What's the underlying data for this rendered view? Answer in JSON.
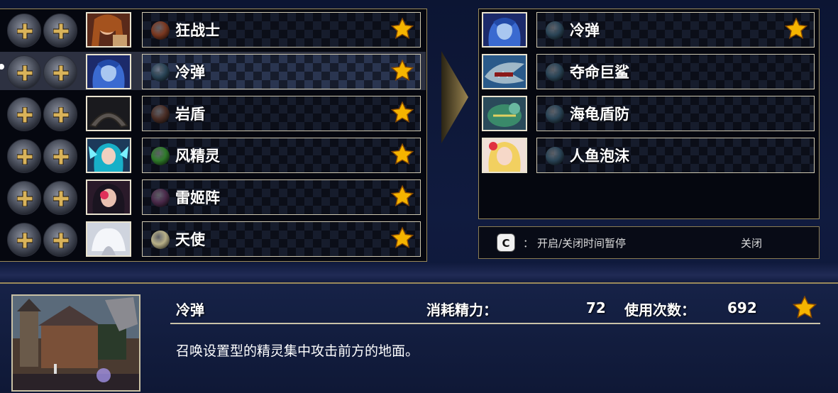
{
  "left_list": {
    "rows": [
      {
        "name": "狂战士",
        "orb_color": "#7a3820",
        "favorite": true
      },
      {
        "name": "冷弹",
        "orb_color": "#2a4456",
        "favorite": true,
        "selected": true
      },
      {
        "name": "岩盾",
        "orb_color": "#4a2e26",
        "favorite": true
      },
      {
        "name": "风精灵",
        "orb_color": "#2f7a2a",
        "favorite": true
      },
      {
        "name": "雷姬阵",
        "orb_color": "#4a2a4a",
        "favorite": true
      },
      {
        "name": "天使",
        "orb_color": "#b8b088",
        "favorite": true
      }
    ]
  },
  "right_list": {
    "rows": [
      {
        "name": "冷弹",
        "orb_color": "#2a4456",
        "favorite": true
      },
      {
        "name": "夺命巨鲨",
        "orb_color": "#2a4456",
        "favorite": false
      },
      {
        "name": "海龟盾防",
        "orb_color": "#2a4456",
        "favorite": false
      },
      {
        "name": "人鱼泡沫",
        "orb_color": "#2a4456",
        "favorite": false
      }
    ]
  },
  "hint": {
    "key": "C",
    "colon": "：",
    "text": "开启/关闭时间暂停",
    "state": "关闭"
  },
  "details": {
    "name": "冷弹",
    "cost_label": "消耗精力：",
    "cost_value": "72",
    "uses_label": "使用次数：",
    "uses_value": "692",
    "favorite": true,
    "description": "召唤设置型的精灵集中攻击前方的地面。"
  },
  "colors": {
    "accent_gold": "#f5b400",
    "frame_border": "#9a8a5a",
    "slot_border": "#cfc8b0"
  }
}
